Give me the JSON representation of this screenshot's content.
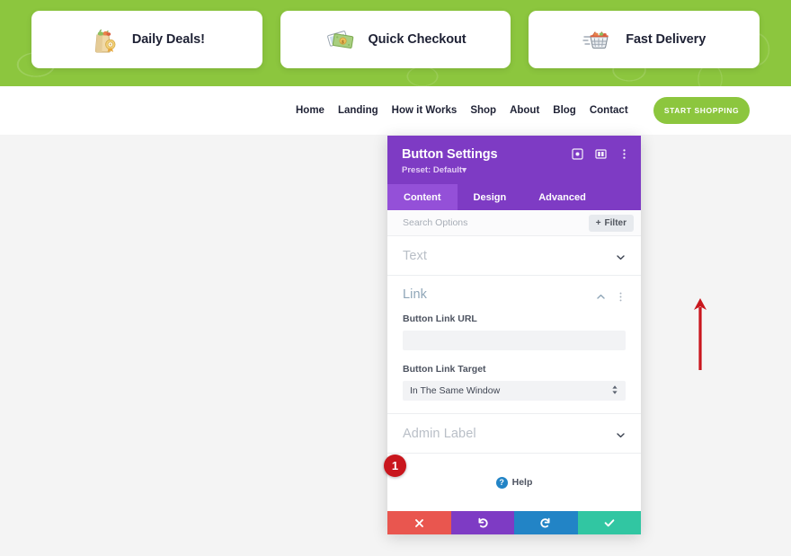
{
  "promo_banner": {
    "background_color": "#8cc63e",
    "cards": [
      {
        "icon": "grocery-bag-award-icon",
        "label": "Daily Deals!"
      },
      {
        "icon": "cash-money-icon",
        "label": "Quick Checkout"
      },
      {
        "icon": "shopping-basket-fast-icon",
        "label": "Fast Delivery"
      }
    ]
  },
  "navbar": {
    "links": [
      {
        "label": "Home"
      },
      {
        "label": "Landing"
      },
      {
        "label": "How it Works"
      },
      {
        "label": "Shop"
      },
      {
        "label": "About"
      },
      {
        "label": "Blog"
      },
      {
        "label": "Contact"
      }
    ],
    "cta": {
      "label": "START SHOPPING",
      "color": "#8cc63e"
    }
  },
  "modal": {
    "title": "Button Settings",
    "preset": "Preset: Default",
    "preset_caret": "▾",
    "header_color": "#7e3bc4",
    "header_icons": [
      {
        "name": "focus-target-icon"
      },
      {
        "name": "layout-panel-icon"
      },
      {
        "name": "more-options-icon"
      }
    ],
    "tabs": [
      {
        "label": "Content",
        "active": true
      },
      {
        "label": "Design",
        "active": false
      },
      {
        "label": "Advanced",
        "active": false
      }
    ],
    "search": {
      "placeholder": "Search Options",
      "value": "",
      "filter_label": "Filter",
      "filter_plus": "+"
    },
    "sections": {
      "text": {
        "title": "Text",
        "expanded": false
      },
      "link": {
        "title": "Link",
        "expanded": true,
        "url_field": {
          "label": "Button Link URL",
          "value": "",
          "placeholder": ""
        },
        "target_field": {
          "label": "Button Link Target",
          "value": "In The Same Window"
        }
      },
      "admin_label": {
        "title": "Admin Label",
        "expanded": false
      }
    },
    "help": {
      "label": "Help",
      "icon_char": "?",
      "color": "#2284c6"
    },
    "footer_buttons": [
      {
        "name": "cancel-button",
        "icon": "✖",
        "color": "#e9564f"
      },
      {
        "name": "undo-button",
        "icon": "↺",
        "color": "#7e3bc4"
      },
      {
        "name": "redo-button",
        "icon": "↻",
        "color": "#2284c6"
      },
      {
        "name": "save-button",
        "icon": "✔",
        "color": "#31c6a2"
      }
    ]
  },
  "annotations": {
    "step_badge": {
      "number": "1",
      "color": "#c9161d"
    },
    "arrow": {
      "direction": "up",
      "color": "#c9161d"
    }
  }
}
